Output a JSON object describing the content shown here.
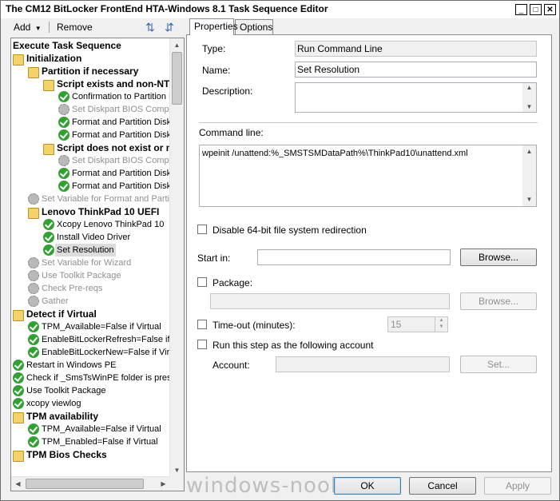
{
  "window": {
    "title": "The CM12 BitLocker FrontEnd HTA-Windows 8.1 Task Sequence Editor"
  },
  "toolbar": {
    "add_label": "Add",
    "remove_label": "Remove"
  },
  "tree": [
    {
      "label": "Execute Task Sequence",
      "type": "root",
      "indent": 0
    },
    {
      "label": "Initialization",
      "type": "group",
      "indent": 1
    },
    {
      "label": "Partition if necessary",
      "type": "group",
      "indent": 2
    },
    {
      "label": "Script exists and non-NT",
      "type": "group",
      "indent": 3
    },
    {
      "label": "Confirmation to Partition D",
      "type": "ok",
      "indent": 4
    },
    {
      "label": "Set Diskpart BIOS Compa",
      "type": "disabled",
      "indent": 4
    },
    {
      "label": "Format and Partition Disk",
      "type": "ok",
      "indent": 4
    },
    {
      "label": "Format and Partition Disk",
      "type": "ok",
      "indent": 4
    },
    {
      "label": "Script does not exist or n",
      "type": "group",
      "indent": 3
    },
    {
      "label": "Set Diskpart BIOS Compa",
      "type": "disabled",
      "indent": 4
    },
    {
      "label": "Format and Partition Disk",
      "type": "ok",
      "indent": 4
    },
    {
      "label": "Format and Partition Disk",
      "type": "ok",
      "indent": 4
    },
    {
      "label": "Set Variable for Format and Partit",
      "type": "disabled",
      "indent": 2
    },
    {
      "label": "Lenovo ThinkPad 10 UEFI",
      "type": "group",
      "indent": 2
    },
    {
      "label": "Xcopy Lenovo ThinkPad 10",
      "type": "ok",
      "indent": 3
    },
    {
      "label": "Install Video Driver",
      "type": "ok",
      "indent": 3
    },
    {
      "label": "Set Resolution",
      "type": "ok",
      "indent": 3,
      "selected": true
    },
    {
      "label": "Set Variable for Wizard",
      "type": "disabled",
      "indent": 2
    },
    {
      "label": "Use Toolkit Package",
      "type": "disabled",
      "indent": 2
    },
    {
      "label": "Check Pre-reqs",
      "type": "disabled",
      "indent": 2
    },
    {
      "label": "Gather",
      "type": "disabled",
      "indent": 2
    },
    {
      "label": "Detect if Virtual",
      "type": "group",
      "indent": 1
    },
    {
      "label": "TPM_Available=False if Virtual",
      "type": "ok",
      "indent": 2
    },
    {
      "label": "EnableBitLockerRefresh=False if",
      "type": "ok",
      "indent": 2
    },
    {
      "label": "EnableBitLockerNew=False if Virt",
      "type": "ok",
      "indent": 2
    },
    {
      "label": "Restart in Windows PE",
      "type": "ok",
      "indent": 1
    },
    {
      "label": "Check if _SmsTsWinPE folder is pres",
      "type": "ok",
      "indent": 1
    },
    {
      "label": "Use Toolkit Package",
      "type": "ok",
      "indent": 1
    },
    {
      "label": "xcopy viewlog",
      "type": "ok",
      "indent": 1
    },
    {
      "label": "TPM availability",
      "type": "group",
      "indent": 1
    },
    {
      "label": "TPM_Available=False if Virtual",
      "type": "ok",
      "indent": 2
    },
    {
      "label": "TPM_Enabled=False if Virtual",
      "type": "ok",
      "indent": 2
    },
    {
      "label": "TPM Bios Checks",
      "type": "group",
      "indent": 1
    }
  ],
  "tabs": {
    "properties": "Properties",
    "options": "Options"
  },
  "form": {
    "type_label": "Type:",
    "type_value": "Run Command Line",
    "name_label": "Name:",
    "name_value": "Set Resolution",
    "description_label": "Description:",
    "description_value": "",
    "command_label": "Command line:",
    "command_value": "wpeinit /unattend:%_SMSTSMDataPath%\\ThinkPad10\\unattend.xml",
    "disable64_label": "Disable 64-bit file system redirection",
    "startin_label": "Start in:",
    "startin_value": "",
    "browse_label": "Browse...",
    "package_label": "Package:",
    "package_value": "",
    "browse2_label": "Browse...",
    "timeout_label": "Time-out (minutes):",
    "timeout_value": "15",
    "runas_label": "Run this step as the following account",
    "account_label": "Account:",
    "account_value": "",
    "set_label": "Set..."
  },
  "buttons": {
    "ok": "OK",
    "cancel": "Cancel",
    "apply": "Apply"
  },
  "watermark": "windows-noob.com"
}
